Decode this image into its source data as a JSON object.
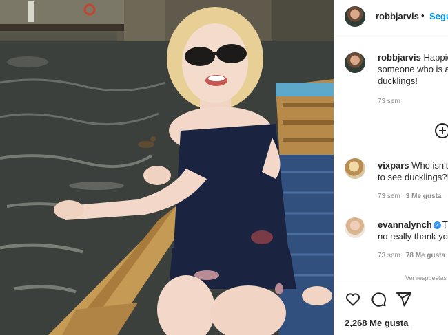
{
  "post": {
    "author": "robbjarvis",
    "follow_label": "Seguir",
    "separator": "•",
    "likes_text": "2,268 Me gusta"
  },
  "caption": {
    "user": "robbjarvis",
    "lines": [
      "Happiest birthday to",
      "someone who is as",
      "ducklings!"
    ],
    "age": "73 sem"
  },
  "comments": [
    {
      "user": "vixpars",
      "lines": [
        "Who isn't",
        "to see ducklings?!"
      ],
      "age": "73 sem",
      "likes": "3 Me gusta"
    },
    {
      "user": "evannalynch",
      "verified": true,
      "lines": [
        "Thank you",
        "no really thank you"
      ],
      "age": "73 sem",
      "likes": "78 Me gusta"
    }
  ],
  "view_replies": "Ver respuestas",
  "icons": [
    "heart-icon",
    "comment-icon",
    "share-icon",
    "add-comment-icon"
  ]
}
